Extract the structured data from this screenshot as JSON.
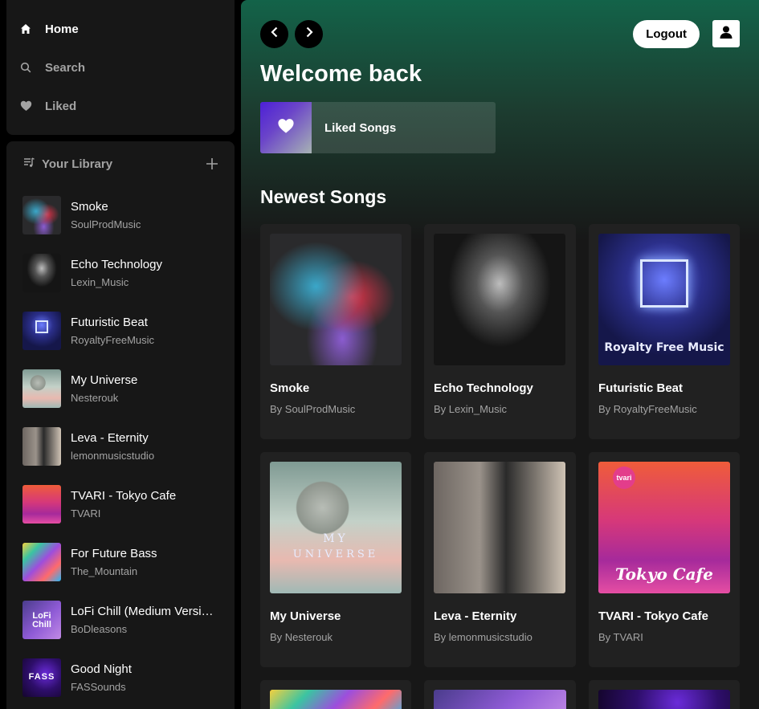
{
  "nav": {
    "items": [
      {
        "label": "Home",
        "icon": "home-icon"
      },
      {
        "label": "Search",
        "icon": "search-icon"
      },
      {
        "label": "Liked",
        "icon": "heart-icon"
      }
    ]
  },
  "library": {
    "title": "Your Library",
    "add_icon": "plus-icon",
    "items": [
      {
        "name": "Smoke",
        "artist": "SoulProdMusic"
      },
      {
        "name": "Echo Technology",
        "artist": "Lexin_Music"
      },
      {
        "name": "Futuristic Beat",
        "artist": "RoyaltyFreeMusic"
      },
      {
        "name": "My Universe",
        "artist": "Nesterouk"
      },
      {
        "name": "Leva - Eternity",
        "artist": "lemonmusicstudio"
      },
      {
        "name": "TVARI - Tokyo Cafe",
        "artist": "TVARI"
      },
      {
        "name": "For Future Bass",
        "artist": "The_Mountain"
      },
      {
        "name": "LoFi Chill (Medium Version)",
        "artist": "BoDleasons"
      },
      {
        "name": "Good Night",
        "artist": "FASSounds"
      }
    ]
  },
  "header": {
    "logout_label": "Logout",
    "back_icon": "chevron-left-icon",
    "forward_icon": "chevron-right-icon",
    "user_icon": "user-icon"
  },
  "main": {
    "welcome": "Welcome back",
    "liked_card_label": "Liked Songs",
    "newest_title": "Newest Songs",
    "songs": [
      {
        "title": "Smoke",
        "by": "By SoulProdMusic"
      },
      {
        "title": "Echo Technology",
        "by": "By Lexin_Music"
      },
      {
        "title": "Futuristic Beat",
        "by": "By RoyaltyFreeMusic"
      },
      {
        "title": "My Universe",
        "by": "By Nesterouk"
      },
      {
        "title": "Leva - Eternity",
        "by": "By lemonmusicstudio"
      },
      {
        "title": "TVARI - Tokyo Cafe",
        "by": "By TVARI"
      }
    ]
  },
  "artwork_text": {
    "futuristic": "Royalty Free Music",
    "universe_line1": "MY",
    "universe_line2": "UNIVERSE",
    "tokyo": "Tokyo Cafe",
    "tvari_badge": "tvari",
    "lofi": "LoFi Chill",
    "fass": "FASS"
  },
  "colors": {
    "accent_green": "#136349",
    "panel": "#171717",
    "card": "#212121",
    "muted_text": "#a3a3a3"
  }
}
